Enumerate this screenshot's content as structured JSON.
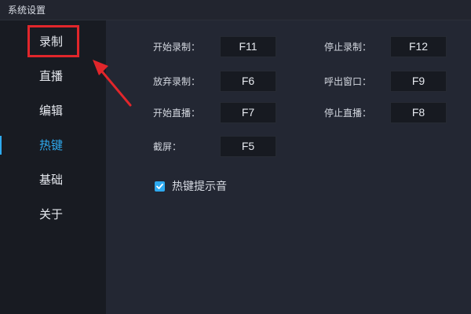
{
  "window": {
    "title": "系统设置"
  },
  "sidebar": {
    "items": [
      {
        "label": "录制"
      },
      {
        "label": "直播"
      },
      {
        "label": "编辑"
      },
      {
        "label": "热键"
      },
      {
        "label": "基础"
      },
      {
        "label": "关于"
      }
    ],
    "active_index": 3
  },
  "hotkeys": {
    "start_record": {
      "label": "开始录制：",
      "key": "F11"
    },
    "stop_record": {
      "label": "停止录制：",
      "key": "F12"
    },
    "discard_record": {
      "label": "放弃录制：",
      "key": "F6"
    },
    "call_window": {
      "label": "呼出窗口：",
      "key": "F9"
    },
    "start_live": {
      "label": "开始直播：",
      "key": "F7"
    },
    "stop_live": {
      "label": "停止直播：",
      "key": "F8"
    },
    "screenshot": {
      "label": "截屏：",
      "key": "F5"
    }
  },
  "hotkey_tip": {
    "label": "热键提示音",
    "checked": true
  },
  "colors": {
    "accent": "#2eaaf0",
    "annotation": "#e1262b"
  },
  "icons": {
    "checkbox": "check-icon",
    "annotation": "red-arrow-icon"
  }
}
